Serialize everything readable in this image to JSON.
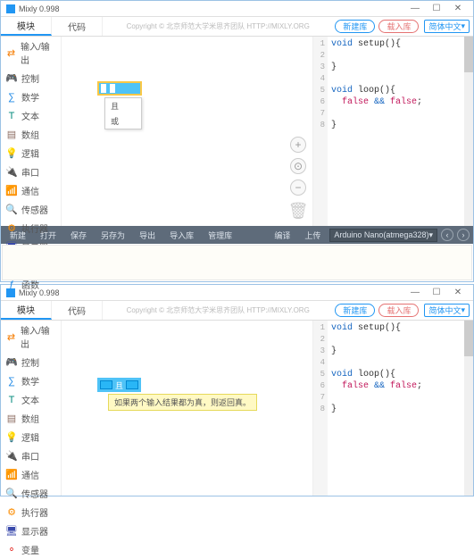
{
  "app": {
    "title": "Mixly 0.998",
    "winctrls": {
      "min": "—",
      "max": "☐",
      "close": "✕"
    }
  },
  "topbar": {
    "tab_blocks": "模块",
    "tab_code": "代码",
    "copyright": "Copyright © 北京师范大学米思齐团队  HTTP://MIXLY.ORG",
    "btn_new_lib": "新建库",
    "btn_add_lib": "载入库",
    "lang": "简体中文",
    "chevron": "▾"
  },
  "sidebar": {
    "items": [
      {
        "icon": "⇄",
        "color": "#f57c00",
        "label": "输入/输出"
      },
      {
        "icon": "🎮",
        "color": "#43a047",
        "label": "控制"
      },
      {
        "icon": "∑",
        "color": "#1e88e5",
        "label": "数学"
      },
      {
        "icon": "T",
        "color": "#00897b",
        "label": "文本"
      },
      {
        "icon": "▤",
        "color": "#8d6e63",
        "label": "数组"
      },
      {
        "icon": "💡",
        "color": "#fbc02d",
        "label": "逻辑"
      },
      {
        "icon": "🔌",
        "color": "#5e35b1",
        "label": "串口"
      },
      {
        "icon": "📶",
        "color": "#43a047",
        "label": "通信"
      },
      {
        "icon": "🔍",
        "color": "#00acc1",
        "label": "传感器"
      },
      {
        "icon": "⚙",
        "color": "#fb8c00",
        "label": "执行器"
      },
      {
        "icon": "🖥",
        "color": "#3949ab",
        "label": "显示器"
      },
      {
        "icon": "⚬",
        "color": "#e53935",
        "label": "变量"
      },
      {
        "icon": "ƒ",
        "color": "#1e88e5",
        "label": "函数"
      }
    ]
  },
  "workspace": {
    "contextmenu": {
      "item1": "且",
      "item2": "或"
    },
    "tooltip": "如果两个输入结果都为真，则返回真。",
    "zoom_in": "+",
    "zoom_reset": "⊙",
    "zoom_out": "−",
    "trash": "🗑"
  },
  "code": {
    "lines": [
      "1",
      "2",
      "3",
      "4",
      "5",
      "6",
      "7",
      "8"
    ],
    "ln1_a": "void",
    "ln1_b": " setup",
    "ln1_c": "(){",
    "ln3": "}",
    "ln5_a": "void",
    "ln5_b": " loop",
    "ln5_c": "(){",
    "ln6_a": "  false",
    "ln6_b": " && ",
    "ln6_c": "false",
    "ln6_d": ";",
    "ln8": "}"
  },
  "bottombar": {
    "new": "新建",
    "open": "打开",
    "save": "保存",
    "saveas": "另存为",
    "export": "导出",
    "importlib": "导入库",
    "manage": "管理库",
    "compile": "编译",
    "upload": "上传",
    "board": "Arduino Nano(atmega328)",
    "chevron": "▾",
    "prev": "‹",
    "next": "›"
  }
}
